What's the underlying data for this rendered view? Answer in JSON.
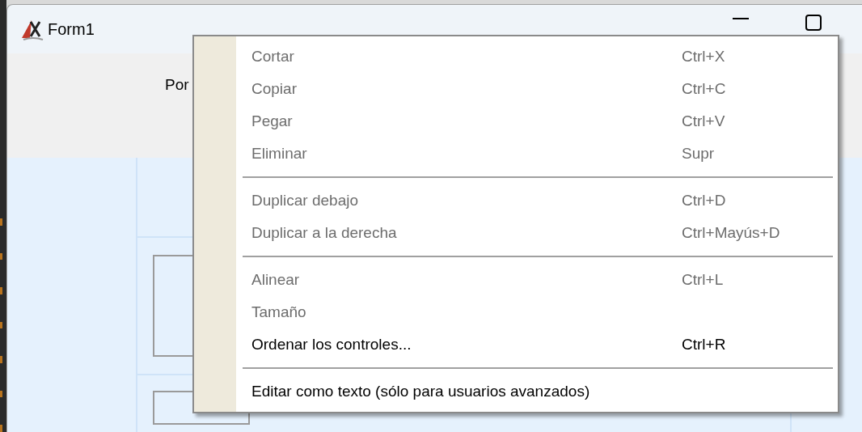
{
  "window": {
    "title": "Form1"
  },
  "toolbar": {
    "label": "Por"
  },
  "context_menu": {
    "items": [
      {
        "kind": "item",
        "label": "Cortar",
        "shortcut": "Ctrl+X",
        "disabled": true
      },
      {
        "kind": "item",
        "label": "Copiar",
        "shortcut": "Ctrl+C",
        "disabled": true
      },
      {
        "kind": "item",
        "label": "Pegar",
        "shortcut": "Ctrl+V",
        "disabled": true
      },
      {
        "kind": "item",
        "label": "Eliminar",
        "shortcut": "Supr",
        "disabled": true
      },
      {
        "kind": "separator"
      },
      {
        "kind": "item",
        "label": "Duplicar debajo",
        "shortcut": "Ctrl+D",
        "disabled": true
      },
      {
        "kind": "item",
        "label": "Duplicar a la derecha",
        "shortcut": "Ctrl+Mayús+D",
        "disabled": true
      },
      {
        "kind": "separator"
      },
      {
        "kind": "item",
        "label": "Alinear",
        "shortcut": "Ctrl+L",
        "disabled": true
      },
      {
        "kind": "item",
        "label": "Tamaño",
        "disabled": true
      },
      {
        "kind": "item",
        "label": "Ordenar los controles...",
        "shortcut": "Ctrl+R",
        "disabled": false
      },
      {
        "kind": "separator"
      },
      {
        "kind": "item",
        "label": "Editar como texto (sólo para usuarios avanzados)",
        "disabled": false
      }
    ]
  }
}
